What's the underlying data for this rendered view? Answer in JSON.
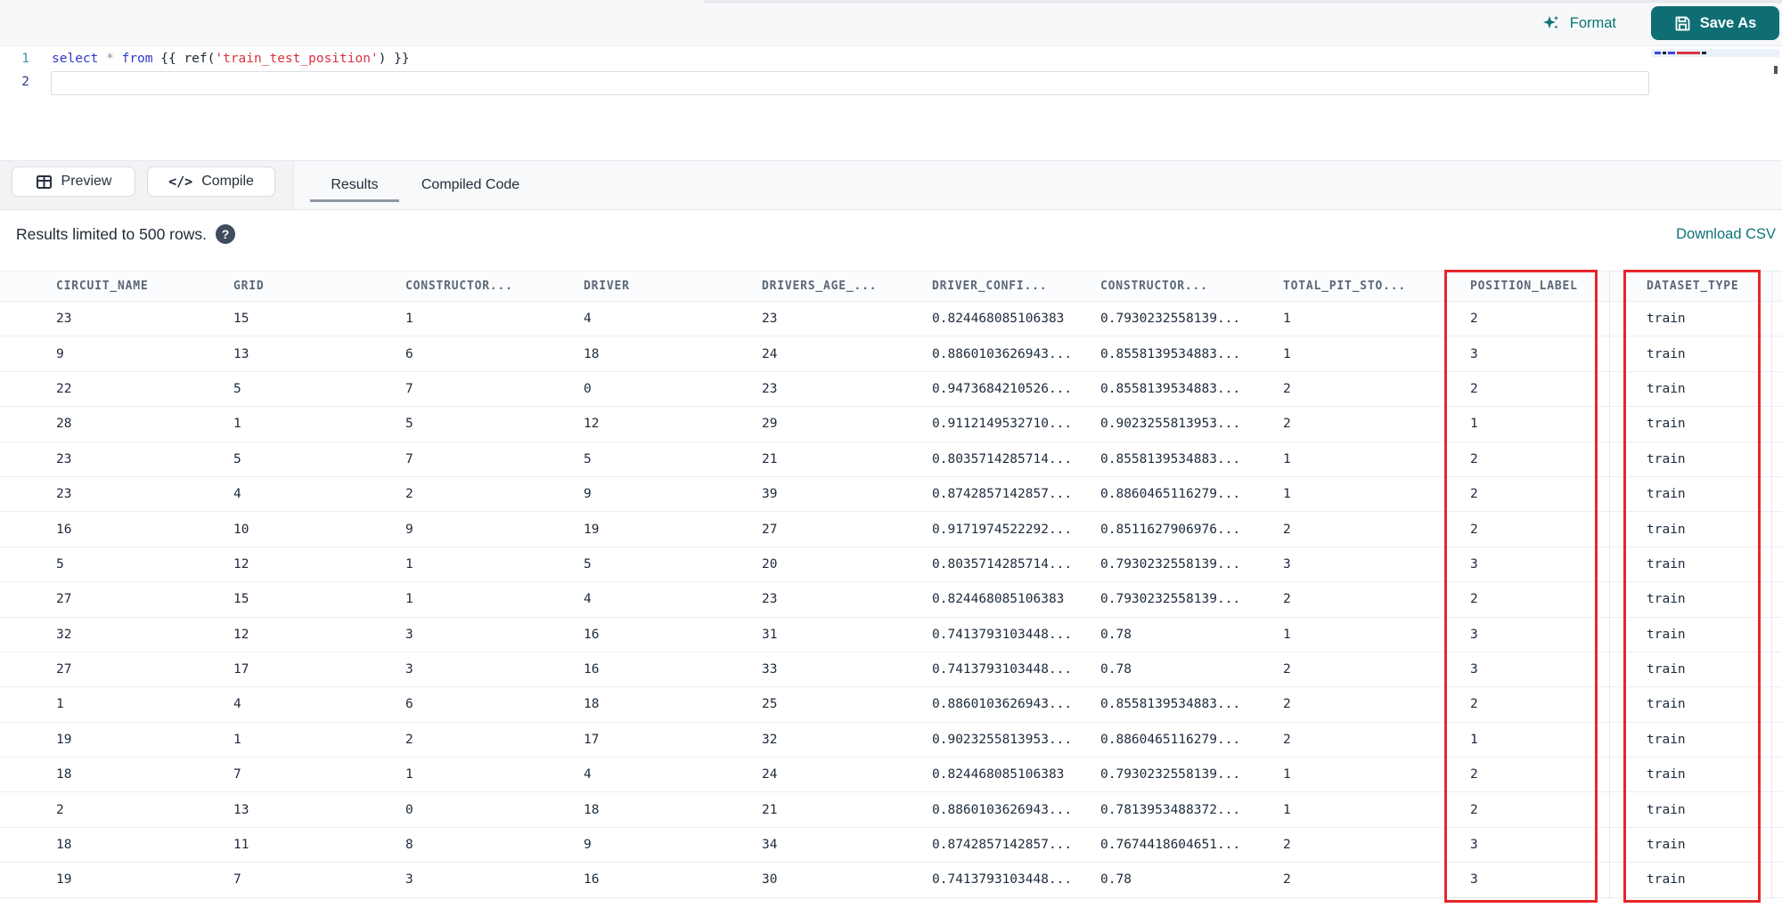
{
  "toolbar": {
    "format_label": "Format",
    "save_as_label": "Save As"
  },
  "editor": {
    "lines": [
      {
        "number": "1",
        "tokens": [
          {
            "text": "select",
            "style": "keyword"
          },
          {
            "text": " ",
            "style": "plain"
          },
          {
            "text": "*",
            "style": "operator"
          },
          {
            "text": " ",
            "style": "plain"
          },
          {
            "text": "from",
            "style": "keyword"
          },
          {
            "text": " {{ ",
            "style": "plain"
          },
          {
            "text": "ref(",
            "style": "plain"
          },
          {
            "text": "'train_test_position'",
            "style": "string"
          },
          {
            "text": ")",
            "style": "plain"
          },
          {
            "text": " }}",
            "style": "plain"
          }
        ]
      },
      {
        "number": "2",
        "tokens": []
      }
    ]
  },
  "actions": {
    "preview_label": "Preview",
    "compile_label": "Compile",
    "compile_icon_glyph": "</>"
  },
  "tabs": [
    {
      "label": "Results",
      "active": true
    },
    {
      "label": "Compiled Code",
      "active": false
    }
  ],
  "results": {
    "limit_note": "Results limited to 500 rows.",
    "help_glyph": "?",
    "download_csv_label": "Download CSV"
  },
  "table": {
    "columns": [
      "CIRCUIT_NAME",
      "GRID",
      "CONSTRUCTOR...",
      "DRIVER",
      "DRIVERS_AGE_...",
      "DRIVER_CONFI...",
      "CONSTRUCTOR...",
      "TOTAL_PIT_STO...",
      "POSITION_LABEL",
      "DATASET_TYPE"
    ],
    "rows": [
      [
        "23",
        "15",
        "1",
        "4",
        "23",
        "0.824468085106383",
        "0.7930232558139...",
        "1",
        "2",
        "train"
      ],
      [
        "9",
        "13",
        "6",
        "18",
        "24",
        "0.8860103626943...",
        "0.8558139534883...",
        "1",
        "3",
        "train"
      ],
      [
        "22",
        "5",
        "7",
        "0",
        "23",
        "0.9473684210526...",
        "0.8558139534883...",
        "2",
        "2",
        "train"
      ],
      [
        "28",
        "1",
        "5",
        "12",
        "29",
        "0.9112149532710...",
        "0.9023255813953...",
        "2",
        "1",
        "train"
      ],
      [
        "23",
        "5",
        "7",
        "5",
        "21",
        "0.8035714285714...",
        "0.8558139534883...",
        "1",
        "2",
        "train"
      ],
      [
        "23",
        "4",
        "2",
        "9",
        "39",
        "0.8742857142857...",
        "0.8860465116279...",
        "1",
        "2",
        "train"
      ],
      [
        "16",
        "10",
        "9",
        "19",
        "27",
        "0.9171974522292...",
        "0.8511627906976...",
        "2",
        "2",
        "train"
      ],
      [
        "5",
        "12",
        "1",
        "5",
        "20",
        "0.8035714285714...",
        "0.7930232558139...",
        "3",
        "3",
        "train"
      ],
      [
        "27",
        "15",
        "1",
        "4",
        "23",
        "0.824468085106383",
        "0.7930232558139...",
        "2",
        "2",
        "train"
      ],
      [
        "32",
        "12",
        "3",
        "16",
        "31",
        "0.7413793103448...",
        "0.78",
        "1",
        "3",
        "train"
      ],
      [
        "27",
        "17",
        "3",
        "16",
        "33",
        "0.7413793103448...",
        "0.78",
        "2",
        "3",
        "train"
      ],
      [
        "1",
        "4",
        "6",
        "18",
        "25",
        "0.8860103626943...",
        "0.8558139534883...",
        "2",
        "2",
        "train"
      ],
      [
        "19",
        "1",
        "2",
        "17",
        "32",
        "0.9023255813953...",
        "0.8860465116279...",
        "2",
        "1",
        "train"
      ],
      [
        "18",
        "7",
        "1",
        "4",
        "24",
        "0.824468085106383",
        "0.7930232558139...",
        "1",
        "2",
        "train"
      ],
      [
        "2",
        "13",
        "0",
        "18",
        "21",
        "0.8860103626943...",
        "0.7813953488372...",
        "1",
        "2",
        "train"
      ],
      [
        "18",
        "11",
        "8",
        "9",
        "34",
        "0.8742857142857...",
        "0.7674418604651...",
        "2",
        "3",
        "train"
      ],
      [
        "19",
        "7",
        "3",
        "16",
        "30",
        "0.7413793103448...",
        "0.78",
        "2",
        "3",
        "train"
      ]
    ],
    "highlighted_columns": [
      "POSITION_LABEL",
      "DATASET_TYPE"
    ]
  },
  "colors": {
    "accent_teal": "#0d7377",
    "save_button_bg": "#0e6e74",
    "highlight_red": "#e8262a",
    "keyword_blue": "#2f36cf",
    "string_red": "#d7333f"
  }
}
